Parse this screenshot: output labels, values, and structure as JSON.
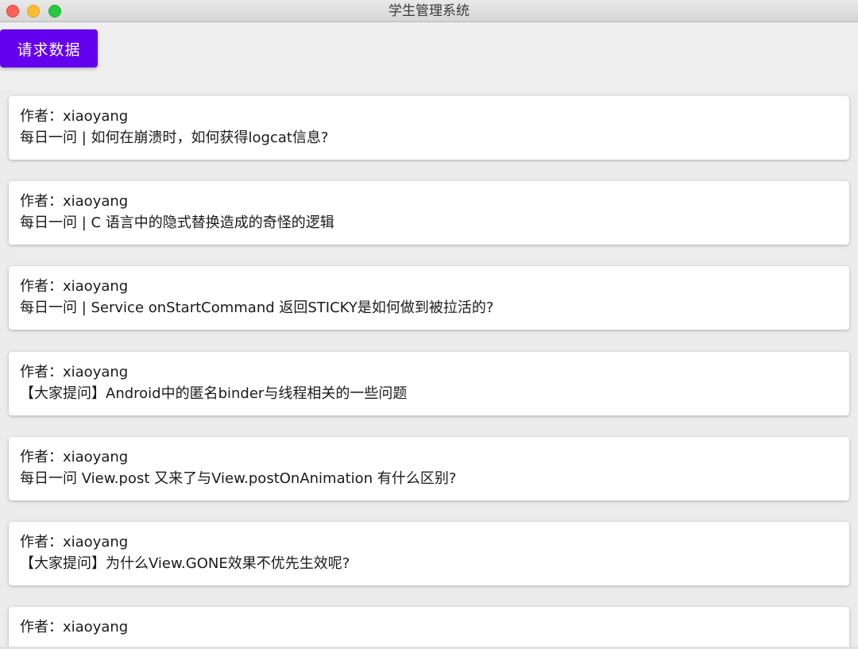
{
  "window": {
    "title": "学生管理系统"
  },
  "toolbar": {
    "request_button_label": "请求数据",
    "accent_color": "#6300ee"
  },
  "list": {
    "items": [
      {
        "author": "作者：xiaoyang",
        "title": "每日一问 | 如何在崩溃时，如何获得logcat信息?"
      },
      {
        "author": "作者：xiaoyang",
        "title": "每日一问 | C 语言中的隐式替换造成的奇怪的逻辑"
      },
      {
        "author": "作者：xiaoyang",
        "title": "每日一问 | Service onStartCommand 返回STICKY是如何做到被拉活的?"
      },
      {
        "author": "作者：xiaoyang",
        "title": "【大家提问】Android中的匿名binder与线程相关的一些问题"
      },
      {
        "author": "作者：xiaoyang",
        "title": "每日一问 View.post 又来了与View.postOnAnimation 有什么区别?"
      },
      {
        "author": "作者：xiaoyang",
        "title": "【大家提问】为什么View.GONE效果不优先生效呢?"
      },
      {
        "author": "作者：xiaoyang",
        "title": ""
      }
    ]
  }
}
